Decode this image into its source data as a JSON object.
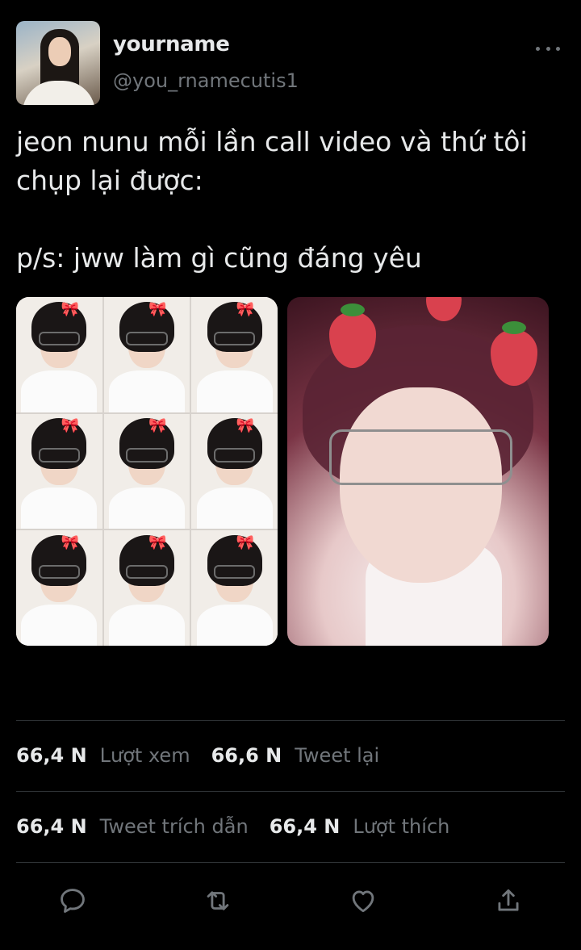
{
  "author": {
    "display_name": "yourname",
    "handle": "@you_rnamecutis1"
  },
  "tweet": {
    "text": "jeon nunu mỗi lần call video và thứ tôi\nchụp lại được:\n\np/s: jww làm gì cũng đáng yêu"
  },
  "stats": {
    "views_count": "66,4 N",
    "views_label": "Lượt xem",
    "retweets_count": "66,6 N",
    "retweets_label": "Tweet lại",
    "quotes_count": "66,4 N",
    "quotes_label": "Tweet trích dẫn",
    "likes_count": "66,4 N",
    "likes_label": "Lượt thích"
  },
  "actions": [
    "reply-icon",
    "retweet-icon",
    "like-icon",
    "share-icon"
  ],
  "colors": {
    "background": "#000000",
    "text_primary": "#e7e9ea",
    "text_secondary": "#71767b",
    "divider": "#2f3336"
  }
}
